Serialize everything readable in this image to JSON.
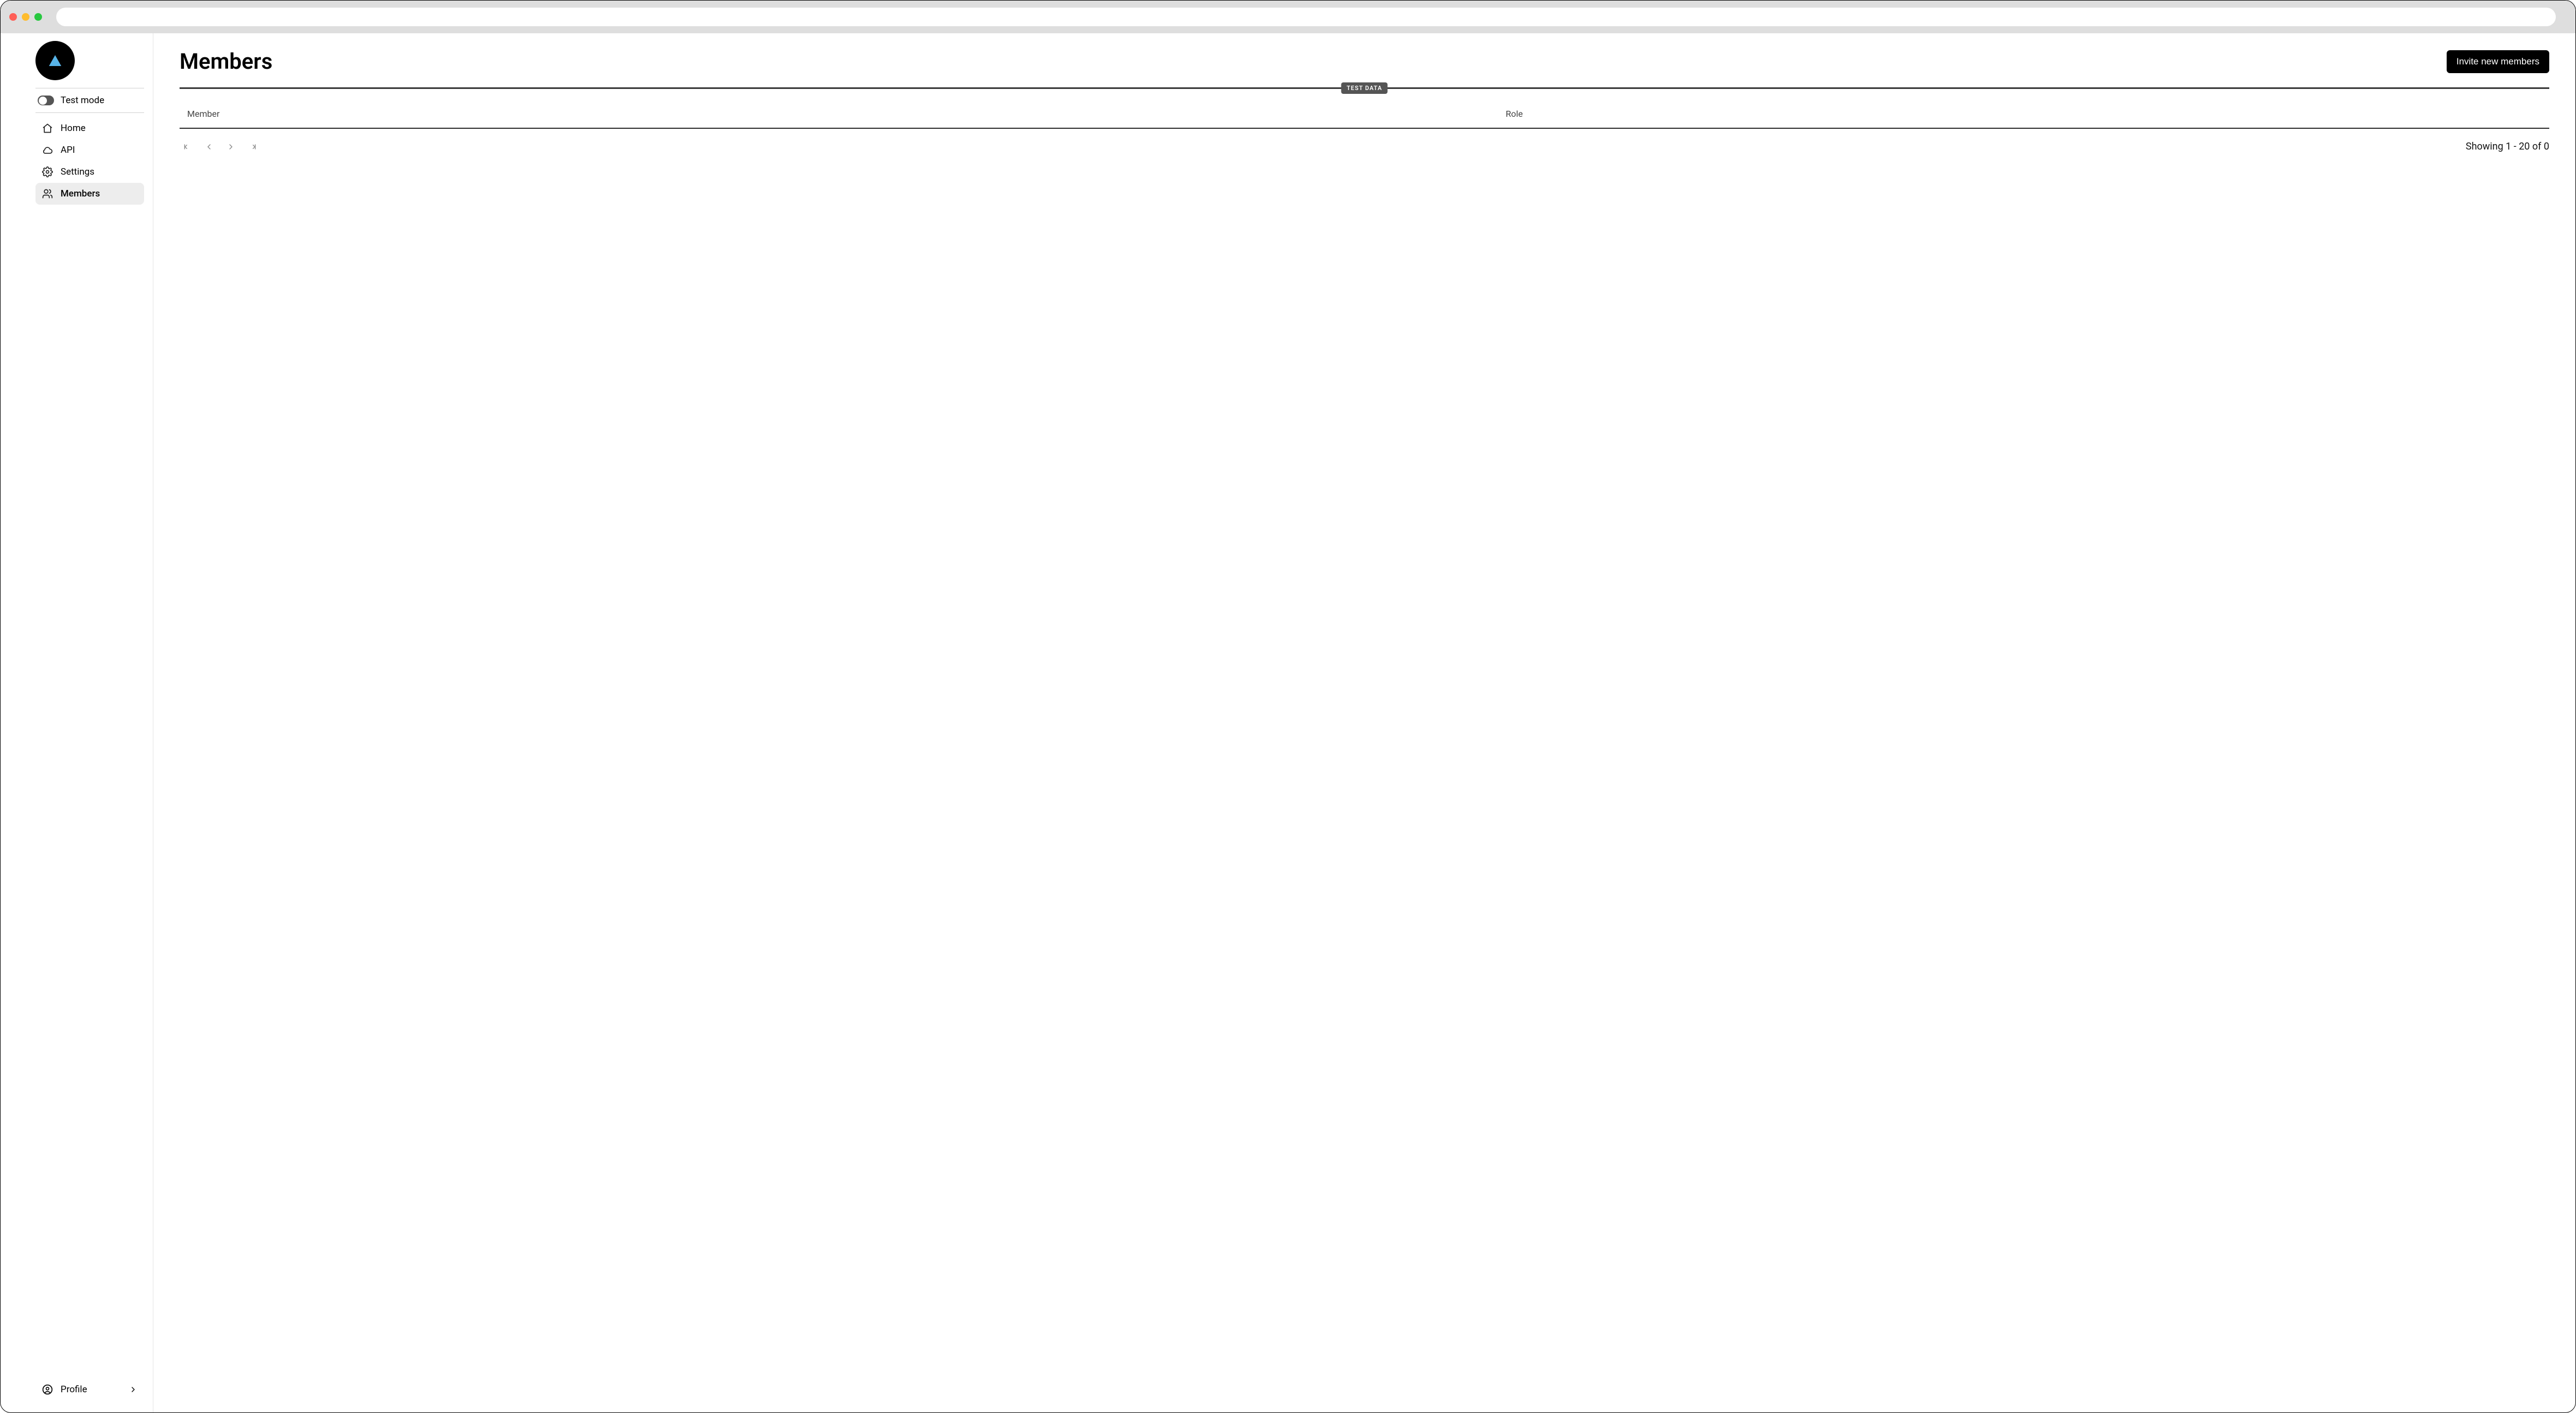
{
  "sidebar": {
    "test_mode_label": "Test mode",
    "nav": [
      {
        "id": "home",
        "label": "Home",
        "icon": "home-icon",
        "active": false
      },
      {
        "id": "api",
        "label": "API",
        "icon": "cloud-icon",
        "active": false
      },
      {
        "id": "settings",
        "label": "Settings",
        "icon": "gear-icon",
        "active": false
      },
      {
        "id": "members",
        "label": "Members",
        "icon": "users-icon",
        "active": true
      }
    ],
    "profile_label": "Profile"
  },
  "page": {
    "title": "Members",
    "invite_button": "Invite new members",
    "badge": "TEST DATA",
    "columns": {
      "member": "Member",
      "role": "Role"
    },
    "pagination_text": "Showing 1 - 20 of 0"
  }
}
